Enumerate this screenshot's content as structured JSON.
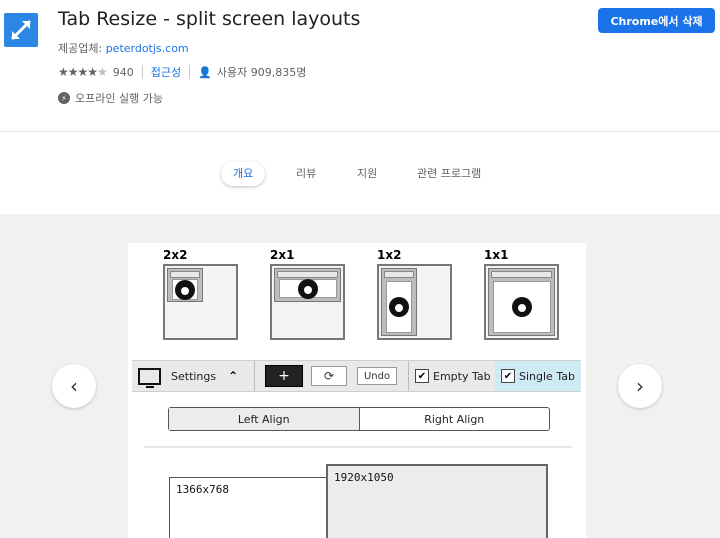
{
  "header": {
    "title": "Tab Resize - split screen layouts",
    "provider_label": "제공업체:",
    "provider_link": "peterdotjs.com",
    "rating_count": "940",
    "category": "접근성",
    "users": "사용자 909,835명",
    "offline": "오프라인 실행 가능",
    "remove_button": "Chrome에서 삭제",
    "rating": 4
  },
  "tabs": [
    {
      "label": "개요",
      "active": true
    },
    {
      "label": "리뷰",
      "active": false
    },
    {
      "label": "지원",
      "active": false
    },
    {
      "label": "관련 프로그램",
      "active": false
    }
  ],
  "screenshot": {
    "layouts": [
      {
        "label": "2x2"
      },
      {
        "label": "2x1"
      },
      {
        "label": "1x2"
      },
      {
        "label": "1x1"
      }
    ],
    "toolbar": {
      "settings": "Settings",
      "undo": "Undo",
      "empty_tab": "Empty Tab",
      "single_tab": "Single Tab"
    },
    "align": {
      "left": "Left Align",
      "right": "Right Align"
    },
    "resolutions": {
      "small": "1366x768",
      "large": "1920x1050"
    }
  },
  "colors": {
    "accent": "#1a73e8",
    "icon_blue": "#2b86e4"
  }
}
